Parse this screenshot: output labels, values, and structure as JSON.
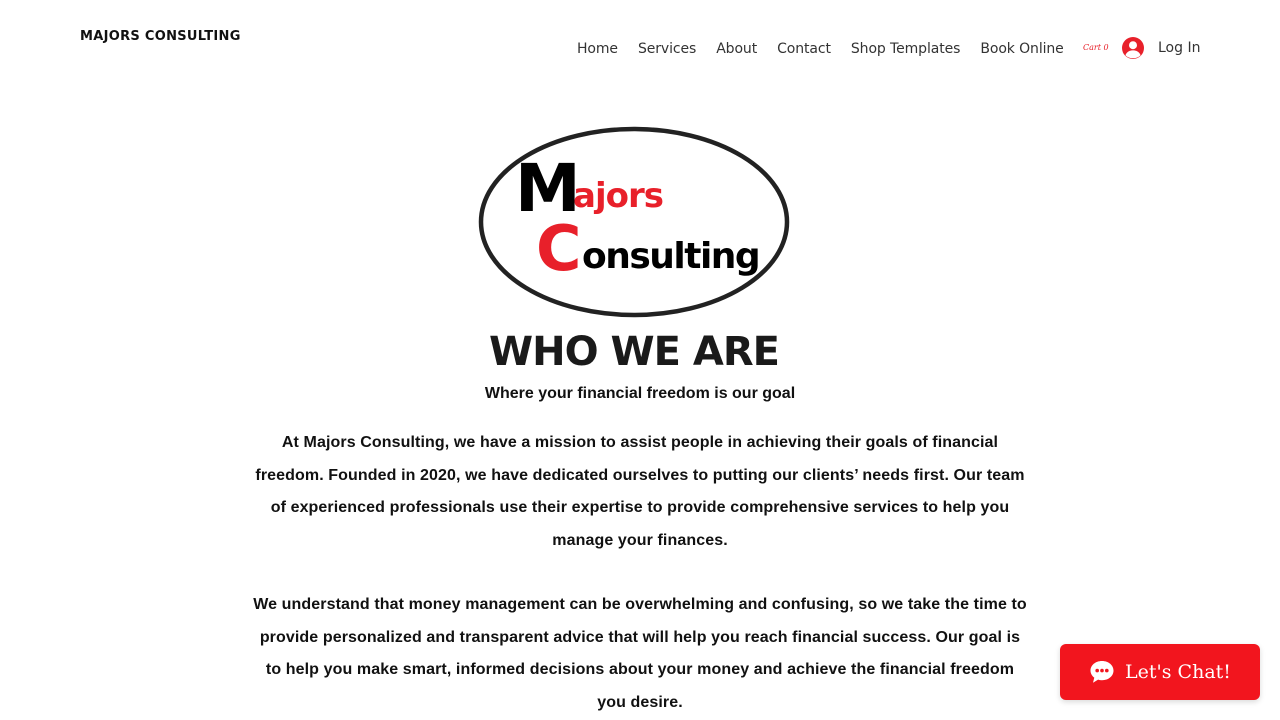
{
  "header": {
    "brand": "MAJORS CONSULTING",
    "nav": [
      {
        "label": "Home"
      },
      {
        "label": "Services"
      },
      {
        "label": "About"
      },
      {
        "label": "Contact"
      },
      {
        "label": "Shop Templates"
      },
      {
        "label": "Book Online"
      }
    ],
    "cart": {
      "label": "Cart",
      "count": "0"
    },
    "login": {
      "label": "Log In",
      "icon": "user-avatar-icon"
    }
  },
  "logo": {
    "word1_initial": "M",
    "word1_rest": "ajors",
    "word2_initial": "C",
    "word2_rest": "onsulting"
  },
  "main": {
    "heading": "WHO WE ARE",
    "subheading": "Where your financial freedom is our goal",
    "paragraphs": [
      "At Majors Consulting, we have a mission to assist people in achieving their goals of financial freedom. Founded in 2020, we have dedicated ourselves to putting our clients’ needs first. Our team of experienced professionals use their expertise to provide comprehensive services to help you manage your finances.",
      "We understand that money management can be overwhelming and confusing, so we take the time to provide personalized and transparent advice that will help you reach financial success. Our goal is to help you make smart, informed decisions about your money and achieve the financial freedom you desire."
    ]
  },
  "chat": {
    "label": "Let's Chat!",
    "icon": "chat-bubble-icon"
  },
  "colors": {
    "accent": "#e8202a",
    "chat_bg": "#f2151e",
    "text": "#111111"
  }
}
